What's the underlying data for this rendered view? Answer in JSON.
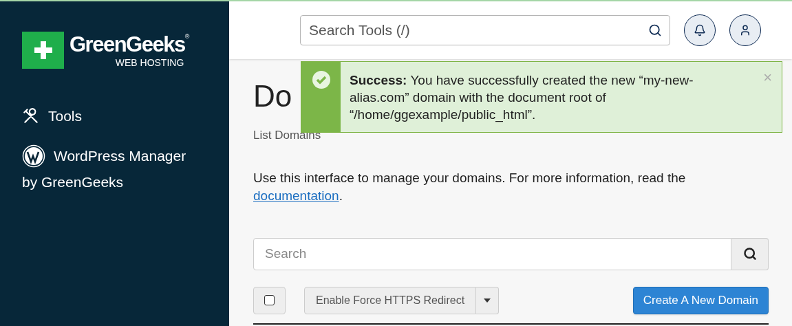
{
  "sidebar": {
    "logo": {
      "name": "GreenGeeks",
      "registered": "®",
      "tagline": "WEB HOSTING"
    },
    "items": [
      {
        "kind": "tools",
        "label": "Tools"
      },
      {
        "kind": "wordpress",
        "label": "WordPress Manager",
        "sublabel": "by GreenGeeks"
      }
    ]
  },
  "top_bar": {
    "search": {
      "placeholder": "Search Tools (/)"
    }
  },
  "alert": {
    "title": "Success:",
    "message": "You have successfully created the new “my-new-alias.com” domain with the document root of “/home/ggexample/public_html”.",
    "close": "×"
  },
  "page": {
    "title": "Do",
    "subtitle": "List Domains",
    "intro": "Use this interface to manage your domains. For more information, read the",
    "link": "documentation",
    "after_link": ".",
    "search": {
      "placeholder": "Search"
    },
    "select_all": {
      "checked": false
    },
    "bulk_action": "Enable Force HTTPS Redirect",
    "create_button": "Create A New Domain"
  }
}
